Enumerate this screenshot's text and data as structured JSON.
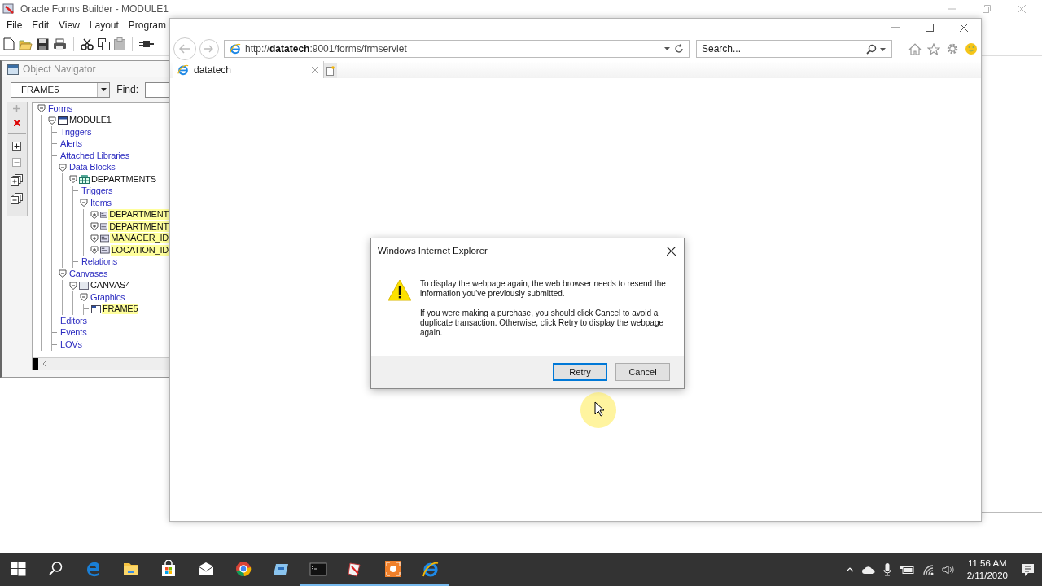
{
  "oracle_window": {
    "title": "Oracle Forms Builder - MODULE1",
    "menu": [
      "File",
      "Edit",
      "View",
      "Layout",
      "Program"
    ]
  },
  "object_navigator": {
    "title": "Object Navigator",
    "context": "FRAME5",
    "find_label": "Find:",
    "tree": [
      {
        "label": "Forms",
        "kind": "category",
        "expanded": true,
        "highlighted": false,
        "children": [
          {
            "label": "MODULE1",
            "kind": "module",
            "expanded": true,
            "highlighted": false,
            "children": [
              {
                "label": "Triggers",
                "kind": "category",
                "highlighted": false
              },
              {
                "label": "Alerts",
                "kind": "category",
                "highlighted": false
              },
              {
                "label": "Attached Libraries",
                "kind": "category",
                "highlighted": false
              },
              {
                "label": "Data Blocks",
                "kind": "category",
                "expanded": true,
                "highlighted": false,
                "children": [
                  {
                    "label": "DEPARTMENTS",
                    "kind": "block",
                    "expanded": true,
                    "highlighted": false,
                    "children": [
                      {
                        "label": "Triggers",
                        "kind": "category",
                        "highlighted": false
                      },
                      {
                        "label": "Items",
                        "kind": "category",
                        "expanded": true,
                        "highlighted": false,
                        "children": [
                          {
                            "label": "DEPARTMENT",
                            "kind": "item",
                            "expanded": false,
                            "highlighted": true
                          },
                          {
                            "label": "DEPARTMENT",
                            "kind": "item",
                            "expanded": false,
                            "highlighted": true
                          },
                          {
                            "label": "MANAGER_ID",
                            "kind": "item",
                            "expanded": false,
                            "highlighted": true
                          },
                          {
                            "label": "LOCATION_ID",
                            "kind": "item",
                            "expanded": false,
                            "highlighted": true
                          }
                        ]
                      },
                      {
                        "label": "Relations",
                        "kind": "category",
                        "highlighted": false
                      }
                    ]
                  }
                ]
              },
              {
                "label": "Canvases",
                "kind": "category",
                "expanded": true,
                "highlighted": false,
                "children": [
                  {
                    "label": "CANVAS4",
                    "kind": "canvas",
                    "expanded": true,
                    "highlighted": false,
                    "children": [
                      {
                        "label": "Graphics",
                        "kind": "category",
                        "expanded": true,
                        "highlighted": false,
                        "children": [
                          {
                            "label": "FRAME5",
                            "kind": "graphic",
                            "highlighted": true
                          }
                        ]
                      }
                    ]
                  }
                ]
              },
              {
                "label": "Editors",
                "kind": "category",
                "highlighted": false
              },
              {
                "label": "Events",
                "kind": "category",
                "highlighted": false
              },
              {
                "label": "LOVs",
                "kind": "category",
                "highlighted": false
              }
            ]
          }
        ]
      }
    ]
  },
  "browser": {
    "address": "http://**datatech**:9001/forms/frmservlet",
    "search_placeholder": "Search...",
    "tabs": [
      {
        "label": "datatech",
        "selected": true
      }
    ]
  },
  "dialog": {
    "title": "Windows Internet Explorer",
    "paragraphs": [
      "To display the webpage again, the web browser needs to resend the information you've previously submitted.",
      "If you were making a purchase, you should click Cancel to avoid a duplicate transaction. Otherwise, click Retry to display the webpage again."
    ],
    "buttons": [
      {
        "label": "Retry",
        "default": true
      },
      {
        "label": "Cancel",
        "default": false
      }
    ]
  },
  "taskbar": {
    "apps": [
      {
        "kind": "start",
        "running": false
      },
      {
        "kind": "search",
        "running": false
      },
      {
        "kind": "edge",
        "running": false
      },
      {
        "kind": "explorer",
        "running": false
      },
      {
        "kind": "store",
        "running": false
      },
      {
        "kind": "mail",
        "running": false
      },
      {
        "kind": "chrome",
        "running": false
      },
      {
        "kind": "remote",
        "running": false
      },
      {
        "kind": "terminal",
        "running": true
      },
      {
        "kind": "forms",
        "running": true
      },
      {
        "kind": "recorder",
        "running": true
      },
      {
        "kind": "ie",
        "running": true
      }
    ],
    "time": "11:56 AM",
    "date": "2/11/2020"
  }
}
